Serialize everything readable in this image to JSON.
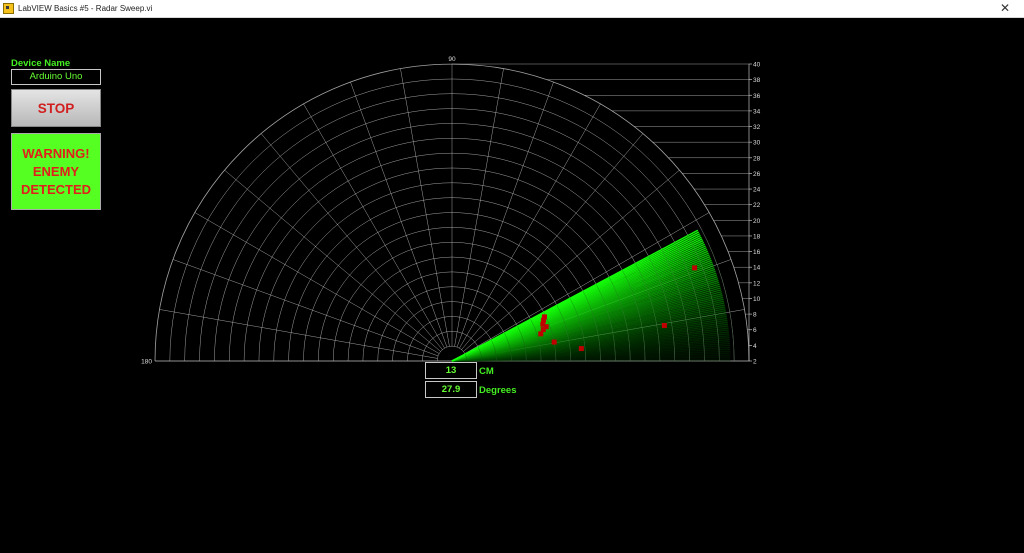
{
  "window": {
    "title": "LabVIEW Basics #5 - Radar Sweep.vi",
    "close_symbol": "✕"
  },
  "colors": {
    "background": "#000000",
    "accent_green": "#66ff33",
    "label_green": "#44ee22",
    "warning_bg": "#55ff22",
    "warning_text": "#e0201a",
    "grid": "#bfbfbf",
    "blip_red": "#c00000"
  },
  "device": {
    "label": "Device Name",
    "value": "Arduino Uno"
  },
  "stop_button": {
    "label": "STOP"
  },
  "warning": {
    "lines": [
      "WARNING!",
      "ENEMY",
      "DETECTED"
    ]
  },
  "readouts": {
    "distance": {
      "value": "13",
      "unit": "CM"
    },
    "angle": {
      "value": "27.9",
      "unit": "Degrees"
    }
  },
  "radar": {
    "r_min": 2,
    "r_max": 40,
    "angle_labels": [
      "90",
      "180"
    ],
    "radial_ticks": [
      "2",
      "4",
      "6",
      "8",
      "10",
      "12",
      "14",
      "16",
      "18",
      "20",
      "22",
      "24",
      "26",
      "28",
      "30",
      "32",
      "34",
      "36",
      "38",
      "40"
    ],
    "sweep_angle_from": 0,
    "sweep_angle_to": 28,
    "blips": [
      {
        "angle": 10.5,
        "r": 14
      },
      {
        "angle": 17,
        "r": 12.5
      },
      {
        "angle": 19,
        "r": 13
      },
      {
        "angle": 20,
        "r": 13.5
      },
      {
        "angle": 22,
        "r": 13.2
      },
      {
        "angle": 24,
        "r": 13.5
      },
      {
        "angle": 25.5,
        "r": 13.8
      },
      {
        "angle": 5.5,
        "r": 17.5
      },
      {
        "angle": 9.5,
        "r": 29
      },
      {
        "angle": 21,
        "r": 35
      }
    ]
  }
}
